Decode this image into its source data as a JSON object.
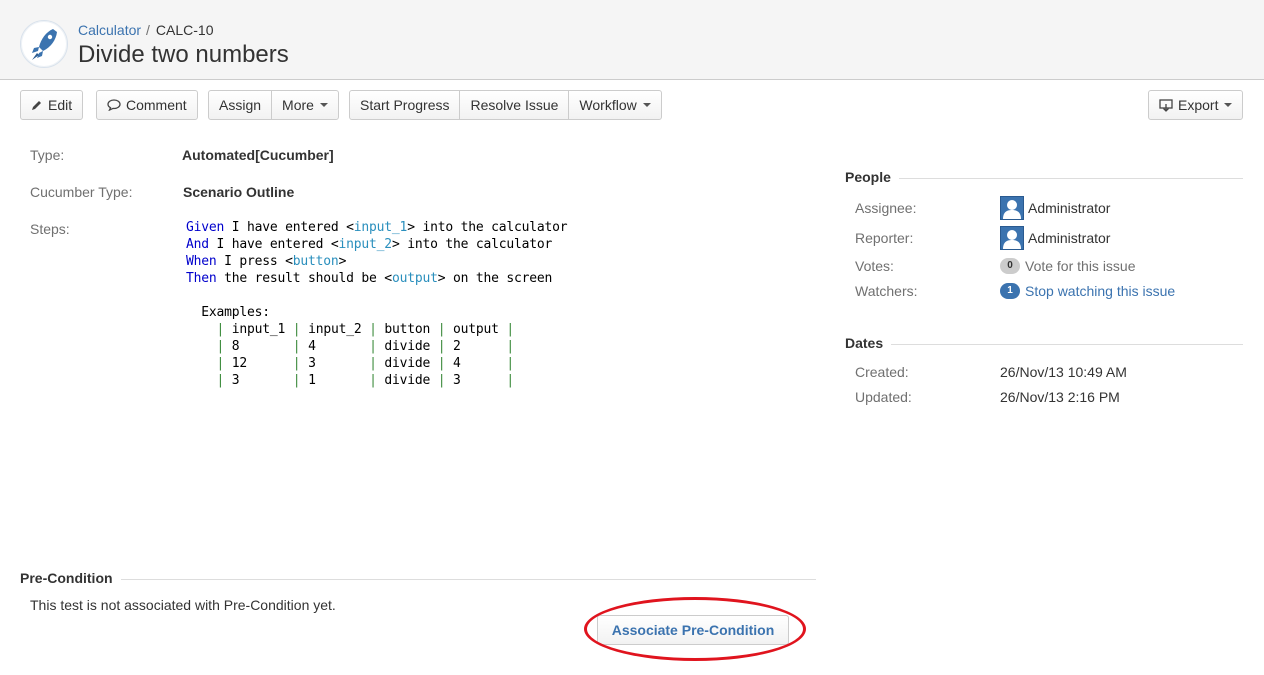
{
  "header": {
    "breadcrumb_project": "Calculator",
    "breadcrumb_separator": "/",
    "breadcrumb_issue": "CALC-10",
    "title": "Divide two numbers",
    "project_icon": "rocket-icon"
  },
  "toolbar": {
    "edit": "Edit",
    "comment": "Comment",
    "assign": "Assign",
    "more": "More",
    "start_progress": "Start Progress",
    "resolve_issue": "Resolve Issue",
    "workflow": "Workflow",
    "export": "Export"
  },
  "details": {
    "type_label": "Type:",
    "type_value": "Automated[Cucumber]",
    "cucumber_type_label": "Cucumber Type:",
    "cucumber_type_value": "Scenario Outline",
    "steps_label": "Steps:"
  },
  "steps": {
    "line1": {
      "kw": "Given",
      "a": " I have entered <",
      "p": "input_1",
      "b": "> into the calculator"
    },
    "line2": {
      "kw": "And",
      "a": " I have entered <",
      "p": "input_2",
      "b": "> into the calculator"
    },
    "line3": {
      "kw": "When",
      "a": " I press <",
      "p": "button",
      "b": ">"
    },
    "line4": {
      "kw": "Then",
      "a": " the result should be <",
      "p": "output",
      "b": "> on the screen"
    },
    "examples_label": "  Examples:",
    "table": [
      [
        "input_1",
        "input_2",
        "button",
        "output"
      ],
      [
        "8",
        "4",
        "divide",
        "2"
      ],
      [
        "12",
        "3",
        "divide",
        "4"
      ],
      [
        "3",
        "1",
        "divide",
        "3"
      ]
    ]
  },
  "people": {
    "heading": "People",
    "assignee_label": "Assignee:",
    "assignee": "Administrator",
    "reporter_label": "Reporter:",
    "reporter": "Administrator",
    "votes_label": "Votes:",
    "votes_count": "0",
    "vote_link": "Vote for this issue",
    "watchers_label": "Watchers:",
    "watchers_count": "1",
    "watch_link": "Stop watching this issue"
  },
  "dates": {
    "heading": "Dates",
    "created_label": "Created:",
    "created": "26/Nov/13 10:49 AM",
    "updated_label": "Updated:",
    "updated": "26/Nov/13 2:16 PM"
  },
  "precondition": {
    "heading": "Pre-Condition",
    "text": "This test is not associated with Pre-Condition yet.",
    "button": "Associate Pre-Condition"
  },
  "colors": {
    "link": "#3b73af",
    "highlight": "#e0141e",
    "keyword": "#0000cc",
    "parameter": "#2a8fbd"
  }
}
